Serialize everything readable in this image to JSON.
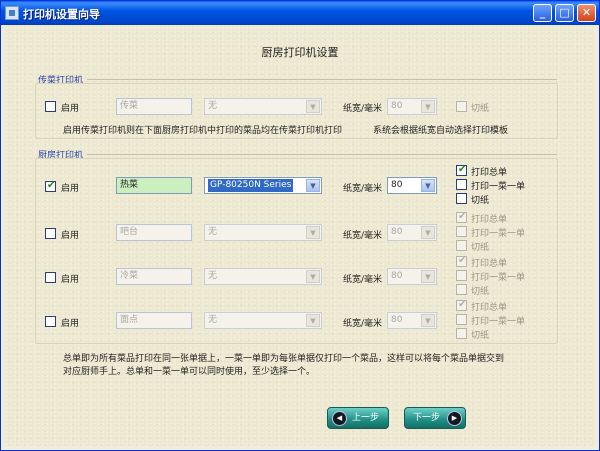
{
  "window": {
    "title": "打印机设置向导",
    "minimize": "_",
    "maximize": "□",
    "close": "✕"
  },
  "page": {
    "heading": "厨房打印机设置"
  },
  "labels": {
    "enable": "启用",
    "paper_width": "纸宽/毫米",
    "cut_paper": "切纸",
    "print_all": "打印总单",
    "print_each": "打印一菜一单"
  },
  "cashier_printer": {
    "section_label": "传菜打印机",
    "name": "传菜",
    "printer": "无",
    "paper_width": "80",
    "notes": [
      "启用传菜打印机则在下面厨房打印机中打印的菜品均在传菜打印机打印",
      "系统会根据纸宽自动选择打印模板"
    ]
  },
  "kitchen_section_label": "厨房打印机",
  "kitchen_printers": [
    {
      "name": "热菜",
      "printer": "GP-80250N Series",
      "paper_width": "80",
      "enabled": true,
      "print_all": true,
      "print_each": false,
      "cut": false
    },
    {
      "name": "吧台",
      "printer": "无",
      "paper_width": "80",
      "enabled": false,
      "print_all": true,
      "print_each": false,
      "cut": false
    },
    {
      "name": "冷菜",
      "printer": "无",
      "paper_width": "80",
      "enabled": false,
      "print_all": true,
      "print_each": false,
      "cut": false
    },
    {
      "name": "面点",
      "printer": "无",
      "paper_width": "80",
      "enabled": false,
      "print_all": true,
      "print_each": false,
      "cut": false
    }
  ],
  "footer_note": [
    "总单即为所有菜品打印在同一张单据上，一菜一单即为每张单据仅打印一个菜品，这样可以将每个菜品单据交到",
    "对应厨师手上。总单和一菜一单可以同时使用，至少选择一个。"
  ],
  "buttons": {
    "prev": "上一步",
    "next": "下一步"
  }
}
